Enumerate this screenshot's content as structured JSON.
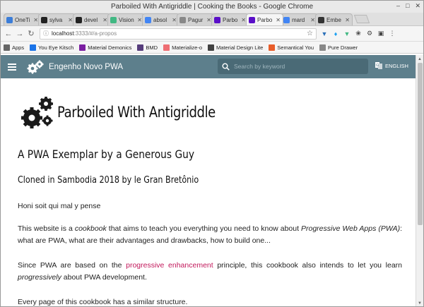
{
  "window": {
    "title": "Parboiled With Antigriddle | Cooking the Books - Google Chrome"
  },
  "tabs": [
    {
      "label": "OneTi",
      "icon": "onetab-icon",
      "color": "#3b7dd8"
    },
    {
      "label": "sylva",
      "icon": "github-icon",
      "color": "#222222"
    },
    {
      "label": "devel",
      "icon": "github-icon",
      "color": "#222222"
    },
    {
      "label": "Vision",
      "icon": "vue-icon",
      "color": "#41b883"
    },
    {
      "label": "absol",
      "icon": "google-icon",
      "color": "#4285f4"
    },
    {
      "label": "Pagur",
      "icon": "page-icon",
      "color": "#888888"
    },
    {
      "label": "Parbo",
      "icon": "pwa-icon",
      "color": "#5a0fc8"
    },
    {
      "label": "Parbo",
      "icon": "pwa-icon",
      "color": "#5a0fc8",
      "active": true
    },
    {
      "label": "mard",
      "icon": "google-icon",
      "color": "#4285f4"
    },
    {
      "label": "Embe",
      "icon": "embed-icon",
      "color": "#333333"
    }
  ],
  "address": {
    "host": "localhost",
    "path": ":3333/#/a-propos"
  },
  "bookmarks": [
    {
      "label": "Apps",
      "icon": "apps-icon",
      "color": "#666666"
    },
    {
      "label": "You Eye Kitsch",
      "icon": "refresh-icon",
      "color": "#1a73e8"
    },
    {
      "label": "Material Demonics",
      "icon": "material-icon",
      "color": "#7b1fa2"
    },
    {
      "label": "BMD",
      "icon": "b-icon",
      "color": "#563d7c"
    },
    {
      "label": "Materialize-o",
      "icon": "m-icon",
      "color": "#ee6e73"
    },
    {
      "label": "Material Design Lite",
      "icon": "mdl-icon",
      "color": "#424242"
    },
    {
      "label": "Semantical You",
      "icon": "semantic-icon",
      "color": "#e85d2a"
    },
    {
      "label": "Pure Drawer",
      "icon": "page-icon",
      "color": "#888888"
    }
  ],
  "app": {
    "title": "Engenho Novo PWA",
    "search_placeholder": "Search by keyword",
    "lang_label": "ENGLISH"
  },
  "colors": {
    "appbar": "#5d7f8c",
    "link": "#c2185b"
  },
  "content": {
    "heading": "Parboiled With Antigriddle",
    "subtitle": "A PWA Exemplar by a Generous Guy",
    "clone_note": "Cloned in Sambodia 2018 by le Gran Bretônio",
    "motto": "Honi soit qui mal y pense",
    "p1_a": "This website is a ",
    "p1_em1": "cookbook",
    "p1_b": " that aims to teach you everything you need to know about ",
    "p1_em2": "Progressive Web Apps (PWA)",
    "p1_c": ": what are PWA, what are their advantages and drawbacks, how to build one...",
    "p2_a": "Since PWA are based on the ",
    "p2_link": "progressive enhancement",
    "p2_b": " principle, this cookbook also intends to let you learn ",
    "p2_em": "progressively",
    "p2_c": " about PWA development.",
    "p3": "Every page of this cookbook has a similar structure."
  }
}
